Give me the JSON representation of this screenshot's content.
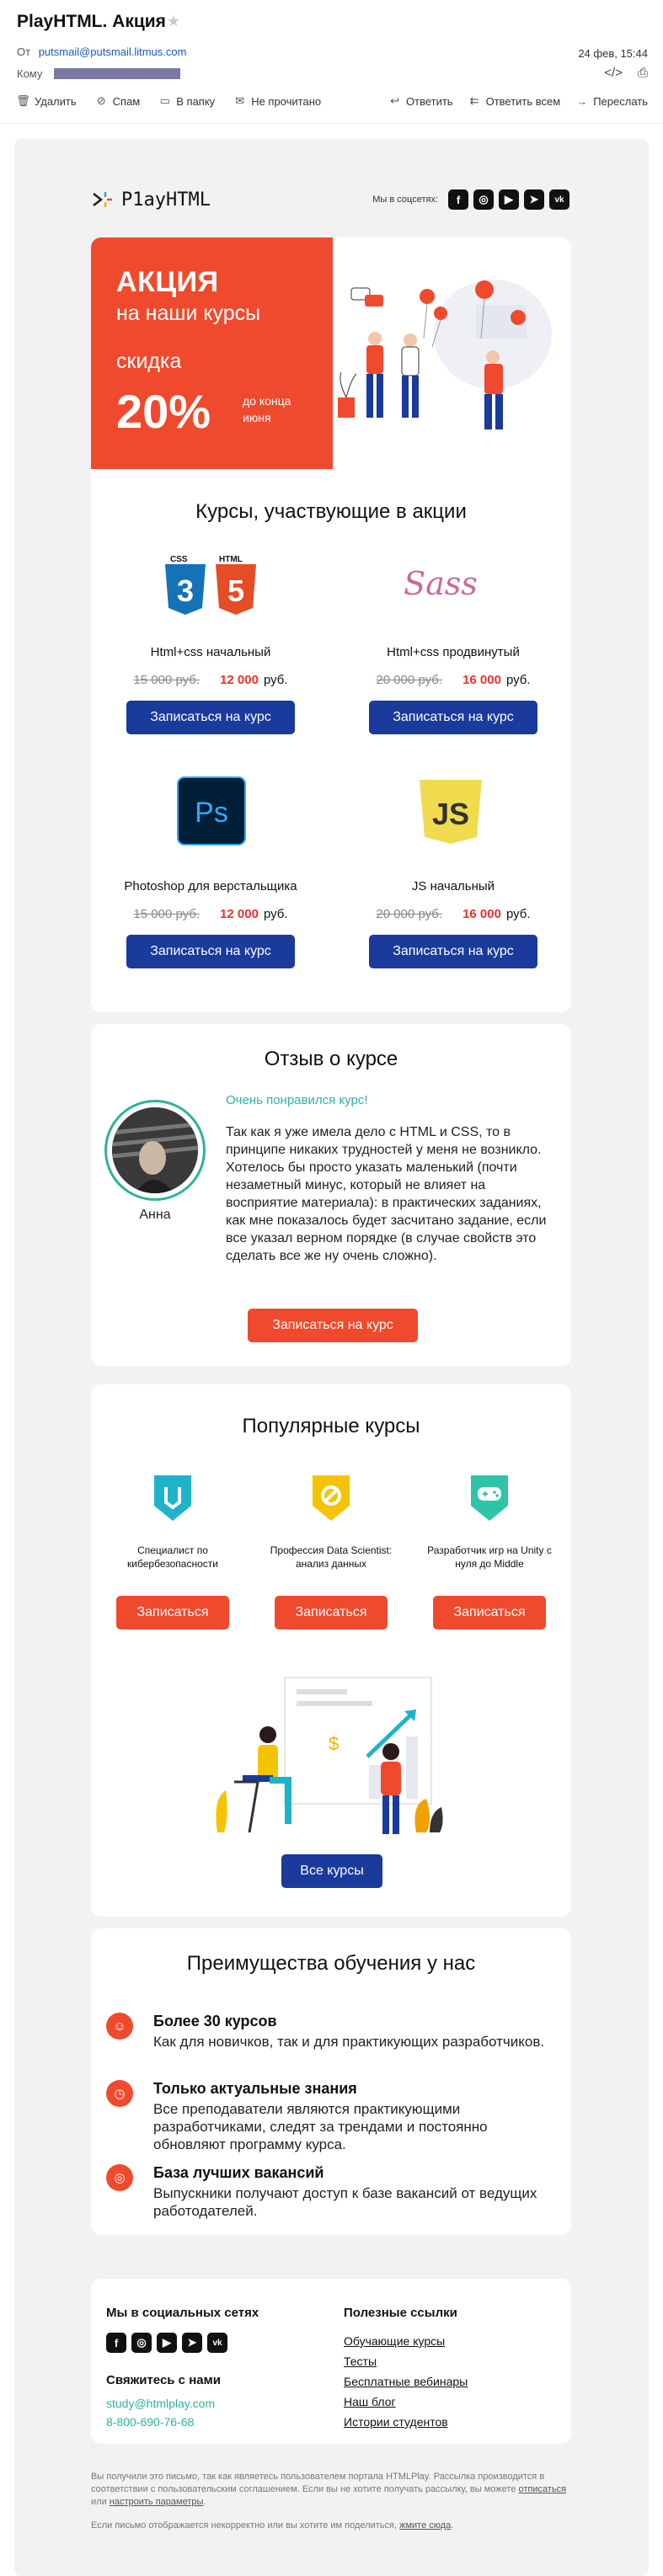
{
  "mail": {
    "subject": "PlayHTML. Акция",
    "from_label": "От",
    "from_address": "putsmail@putsmail.litmus.com",
    "to_label": "Кому",
    "date": "24 фев, 15:44",
    "toolbar": {
      "delete": "Удалить",
      "spam": "Спам",
      "to_folder": "В папку",
      "unread": "Не прочитано",
      "reply": "Ответить",
      "reply_all": "Ответить всем",
      "forward": "Переслать"
    }
  },
  "brand": {
    "logo_text": "P1ayHTML",
    "social_label": "Мы в соцсетях:",
    "social_icons": [
      "facebook-icon",
      "instagram-icon",
      "youtube-icon",
      "telegram-icon",
      "vk-icon"
    ]
  },
  "banner": {
    "line1": "АКЦИЯ",
    "line2": "на наши курсы",
    "line3": "скидка",
    "percent": "20%",
    "until": "до конца июня"
  },
  "courses": {
    "title": "Курсы, участвующие в акции",
    "currency": "руб.",
    "button": "Записаться на курс",
    "items": [
      {
        "name": "Html+css начальный",
        "old_price": "15 000 руб.",
        "new_price": "12 000"
      },
      {
        "name": "Html+css продвинутый",
        "old_price": "20 000 руб.",
        "new_price": "16 000"
      },
      {
        "name": "Photoshop для верстальщика",
        "old_price": "15 000 руб.",
        "new_price": "12 000"
      },
      {
        "name": "JS начальный",
        "old_price": "20 000 руб.",
        "new_price": "16 000"
      }
    ],
    "icon_labels": {
      "css": "CSS",
      "html": "HTML",
      "sass": "Sass",
      "ps": "Ps",
      "js": "JS"
    }
  },
  "review": {
    "title": "Отзыв о курсе",
    "headline": "Очень понравился курс!",
    "text": "Так как я уже имела дело с HTML и CSS, то в принципе никаких трудностей у меня не возникло. Хотелось бы просто указать маленький (почти незаметный минус, который не влияет на восприятие материала): в практических заданиях, как мне показалось будет засчитано задание, если все указал верном порядке (в случае свойств это сделать все же ну очень сложно).",
    "author": "Анна",
    "button": "Записаться на курс"
  },
  "popular": {
    "title": "Популярные курсы",
    "button": "Записаться",
    "all_button": "Все курсы",
    "items": [
      {
        "name": "Специалист по кибербезопасности"
      },
      {
        "name": "Профессия Data Scientist: анализ данных"
      },
      {
        "name": "Разработчик игр на Unity с нуля до Middle"
      }
    ]
  },
  "advantages": {
    "title": "Преимущества обучения у нас",
    "items": [
      {
        "title": "Более 30 курсов",
        "text": "Как для новичков, так и для практикующих разработчиков.",
        "icon": "smile-icon"
      },
      {
        "title": "Только актуальные знания",
        "text": "Все преподаватели являются практикующими разработчиками, следят за трендами и постоянно обновляют программу курса.",
        "icon": "clock-icon"
      },
      {
        "title": "База лучших вакансий",
        "text": "Выпускники получают доступ к базе вакансий от ведущих работодателей.",
        "icon": "target-icon"
      }
    ]
  },
  "footer": {
    "social_title": "Мы в социальных сетях",
    "contact_title": "Свяжитесь с нами",
    "email": "study@htmlplay.com",
    "phone": "8-800-690-76-68",
    "links_title": "Полезные ссылки",
    "links": [
      "Обучающие курсы",
      "Тесты",
      "Бесплатные вебинары",
      "Наш блог",
      "Истории студентов"
    ],
    "disclaimer1_pre": "Вы получили это письмо, так как являетесь пользователем портала HTMLPlay. Рассылка производится в соответствии с пользовательским соглашением. Если вы не хотите получать рассылку, вы можете",
    "unsubscribe": "отписаться",
    "or": "или",
    "settings": "настроить параметры",
    "disclaimer2_pre": "Если письмо отображается некорректно или вы хотите им поделиться,",
    "view_link": "жмите сюда"
  },
  "colors": {
    "accent_red": "#f04a2e",
    "button_blue": "#1a3a9c",
    "green": "#2fb39a",
    "price_red": "#e8332a"
  }
}
